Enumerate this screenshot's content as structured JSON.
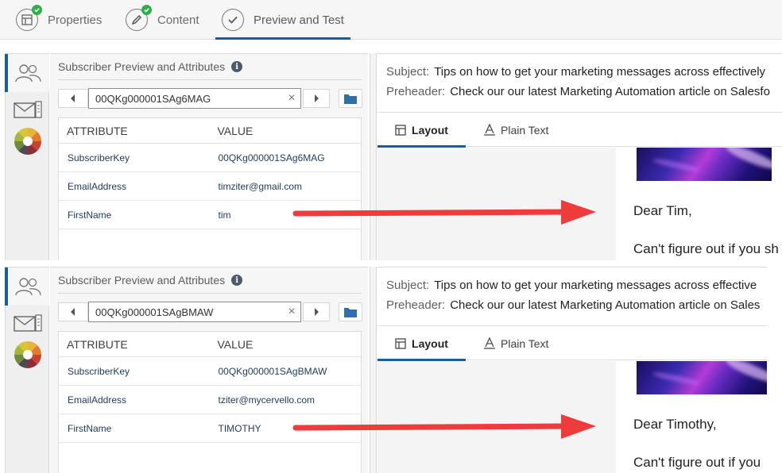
{
  "top_tabs": [
    {
      "label": "Properties",
      "icon": "properties-icon",
      "complete": true
    },
    {
      "label": "Content",
      "icon": "pencil-icon",
      "complete": true
    },
    {
      "label": "Preview and Test",
      "icon": "checkmark-icon",
      "active": true
    }
  ],
  "panels": [
    {
      "attributes_title": "Subscriber Preview and Attributes",
      "subscriber_key_value": "00QKg000001SAg6MAG",
      "table_headers": [
        "ATTRIBUTE",
        "VALUE"
      ],
      "rows": [
        {
          "attribute": "SubscriberKey",
          "value": "00QKg000001SAg6MAG"
        },
        {
          "attribute": "EmailAddress",
          "value": "timziter@gmail.com"
        },
        {
          "attribute": "FirstName",
          "value": "tim"
        }
      ],
      "subject_label": "Subject:",
      "subject": "Tips on how to get your marketing messages across effectively",
      "preheader_label": "Preheader:",
      "preheader": "Check our our latest Marketing Automation article on Salesfo",
      "preview_tabs": [
        "Layout",
        "Plain Text"
      ],
      "greeting": "Dear Tim,",
      "body_line": "Can't figure out if you sh"
    },
    {
      "attributes_title": "Subscriber Preview and Attributes",
      "subscriber_key_value": "00QKg000001SAgBMAW",
      "table_headers": [
        "ATTRIBUTE",
        "VALUE"
      ],
      "rows": [
        {
          "attribute": "SubscriberKey",
          "value": "00QKg000001SAgBMAW"
        },
        {
          "attribute": "EmailAddress",
          "value": "tziter@mycervello.com"
        },
        {
          "attribute": "FirstName",
          "value": "TIMOTHY"
        }
      ],
      "subject_label": "Subject:",
      "subject": "Tips on how to get your marketing messages across effective",
      "preheader_label": "Preheader:",
      "preheader": "Check our our latest Marketing Automation article on Sales",
      "preview_tabs": [
        "Layout",
        "Plain Text"
      ],
      "greeting": "Dear Timothy,",
      "body_line": "Can't figure out if you"
    }
  ],
  "colors": {
    "accent": "#1b5c9a",
    "complete_badge": "#2eae4a",
    "annotation_arrow": "#ee3b3b"
  }
}
